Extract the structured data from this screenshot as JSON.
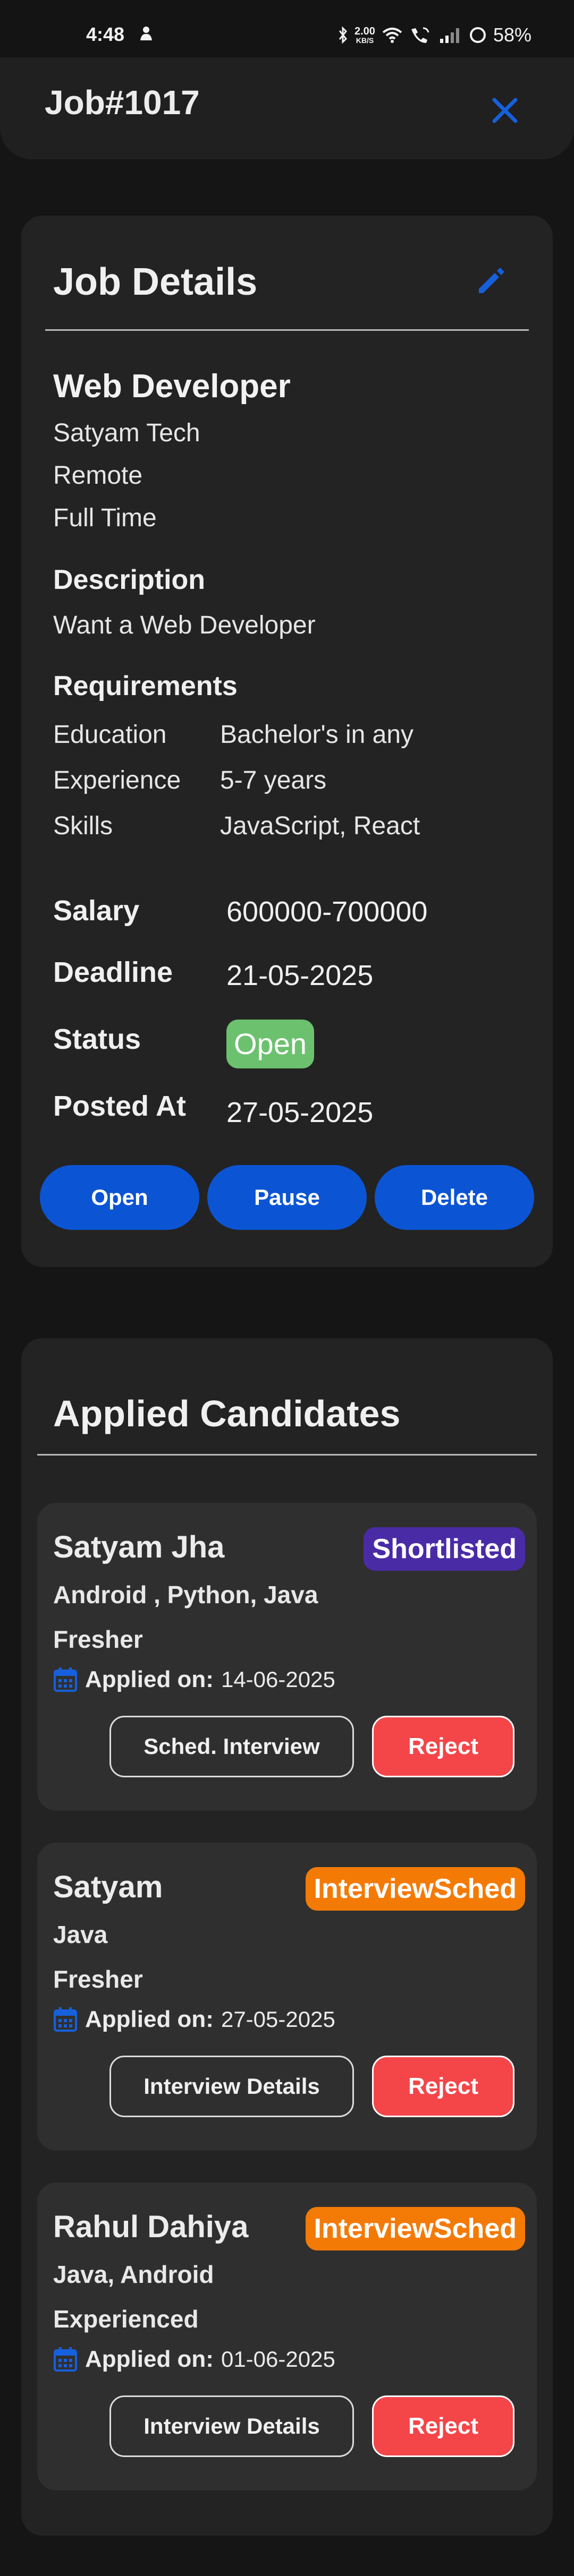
{
  "status_bar": {
    "time": "4:48",
    "net_speed_value": "2.00",
    "net_speed_unit": "KB/S",
    "battery": "58%"
  },
  "header": {
    "title": "Job#1017",
    "close_icon": "close-icon",
    "accent": "#0b55d4"
  },
  "job": {
    "heading": "Job Details",
    "edit_icon": "pencil-icon",
    "title": "Web Developer",
    "company": "Satyam Tech",
    "location": "Remote",
    "type": "Full Time",
    "description_label": "Description",
    "description": "Want a Web Developer",
    "requirements_label": "Requirements",
    "requirements": [
      {
        "key": "Education",
        "value": "Bachelor's in any"
      },
      {
        "key": "Experience",
        "value": "5-7 years"
      },
      {
        "key": "Skills",
        "value": "JavaScript, React"
      }
    ],
    "salary_label": "Salary",
    "salary": "600000-700000",
    "deadline_label": "Deadline",
    "deadline": "21-05-2025",
    "status_label": "Status",
    "status": "Open",
    "status_color": "#6cc16f",
    "posted_label": "Posted At",
    "posted": "27-05-2025",
    "actions": {
      "open": "Open",
      "pause": "Pause",
      "delete": "Delete"
    }
  },
  "candidates": {
    "heading": "Applied Candidates",
    "applied_label": "Applied on:",
    "reject_label": "Reject",
    "reject_color": "#f44549",
    "items": [
      {
        "name": "Satyam Jha",
        "badge": "Shortlisted",
        "badge_color": "#4a2ba6",
        "skills": "Android , Python, Java",
        "experience": "Fresher",
        "applied_on": "14-06-2025",
        "primary_action": "Sched. Interview"
      },
      {
        "name": "Satyam",
        "badge": "InterviewSched",
        "badge_color": "#f47a06",
        "skills": "Java",
        "experience": "Fresher",
        "applied_on": "27-05-2025",
        "primary_action": "Interview Details"
      },
      {
        "name": "Rahul Dahiya",
        "badge": "InterviewSched",
        "badge_color": "#f47a06",
        "skills": "Java, Android",
        "experience": "Experienced",
        "applied_on": "01-06-2025",
        "primary_action": "Interview Details"
      }
    ]
  }
}
